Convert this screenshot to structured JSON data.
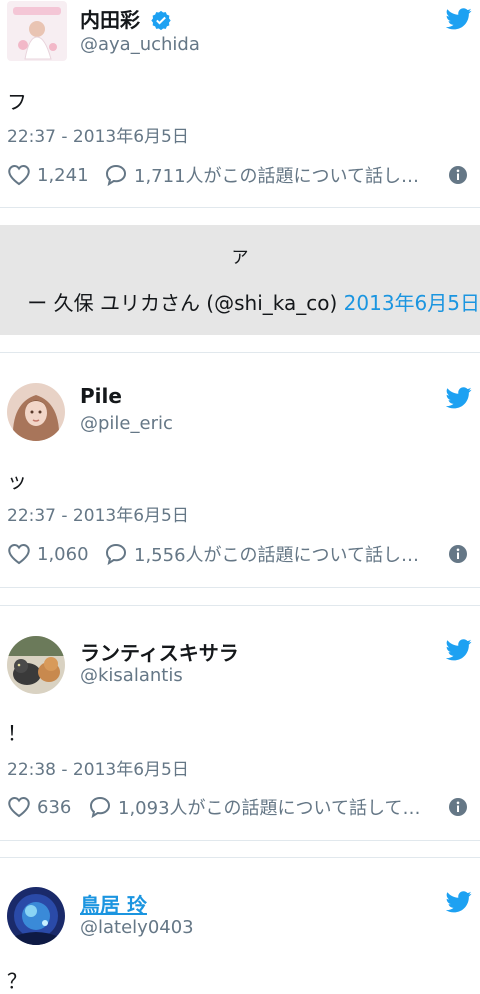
{
  "tweets": [
    {
      "name": "内田彩",
      "handle": "@aya_uchida",
      "text": "フ",
      "time": "22:37 - 2013年6月5日",
      "likes": "1,241",
      "replies": "1,711人がこの話題について話し…",
      "verified": true
    },
    {
      "name": "Pile",
      "handle": "@pile_eric",
      "text": "ッ",
      "time": "22:37 - 2013年6月5日",
      "likes": "1,060",
      "replies": "1,556人がこの話題について話し…"
    },
    {
      "name": "ランティスキサラ",
      "handle": "@kisalantis",
      "text": "！",
      "time": "22:38 - 2013年6月5日",
      "likes": "636",
      "replies": "1,093人がこの話題について話して…"
    },
    {
      "name": "鳥居 玲",
      "handle": "@lately0403",
      "text": "？"
    }
  ],
  "embed": {
    "top_text": "ア",
    "author_line": "ー 久保 ユリカさん (@shi_ka_co) ",
    "date_link": "2013年6月5日"
  },
  "colors": {
    "twitter_blue": "#1da1f2",
    "link_blue": "#1b95e0",
    "text_gray": "#657786",
    "embed_bg": "#e6e6e6"
  },
  "icons": [
    "twitter-bird-icon",
    "verified-badge-icon",
    "heart-icon",
    "reply-bubble-icon",
    "info-icon"
  ]
}
